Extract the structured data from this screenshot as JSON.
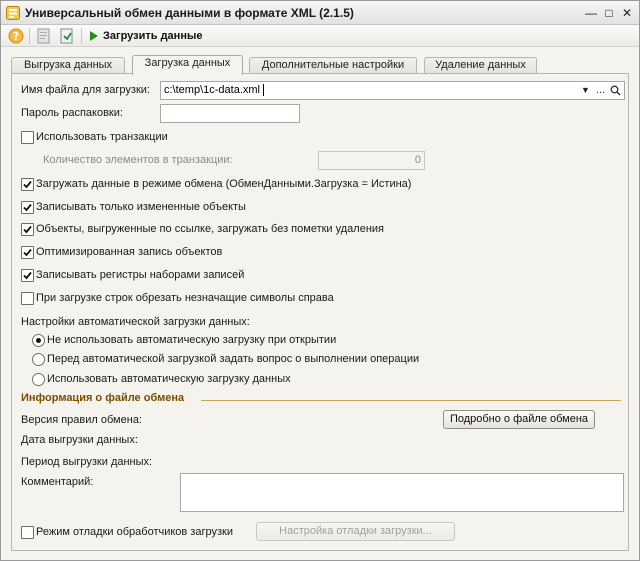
{
  "window": {
    "title": "Универсальный обмен данными в формате XML (2.1.5)"
  },
  "toolbar": {
    "load_label": "Загрузить данные"
  },
  "tabs": [
    {
      "label": "Выгрузка данных"
    },
    {
      "label": "Загрузка данных"
    },
    {
      "label": "Дополнительные настройки"
    },
    {
      "label": "Удаление данных"
    }
  ],
  "load": {
    "file_label": "Имя файла для загрузки:",
    "file_value": "c:\\temp\\1c-data.xml",
    "ellipsis": "...",
    "password_label": "Пароль распаковки:",
    "password_value": "",
    "use_transactions_label": "Использовать транзакции",
    "use_transactions_checked": false,
    "tx_count_label": "Количество элементов в транзакции:",
    "tx_count_value": "0",
    "options": [
      {
        "label": "Загружать данные в режиме обмена (ОбменДанными.Загрузка = Истина)",
        "checked": true
      },
      {
        "label": "Записывать только измененные объекты",
        "checked": true
      },
      {
        "label": "Объекты, выгруженные по ссылке, загружать без пометки удаления",
        "checked": true
      },
      {
        "label": "Оптимизированная запись объектов",
        "checked": true
      },
      {
        "label": "Записывать регистры наборами записей",
        "checked": true
      },
      {
        "label": "При загрузке строк обрезать незначащие символы справа",
        "checked": false
      }
    ],
    "auto_label": "Настройки автоматической загрузки данных:",
    "auto_options": [
      {
        "label": "Не использовать автоматическую загрузку при открытии",
        "selected": true
      },
      {
        "label": "Перед автоматической загрузкой задать вопрос о выполнении операции",
        "selected": false
      },
      {
        "label": "Использовать автоматическую загрузку данных",
        "selected": false
      }
    ]
  },
  "info": {
    "section_title": "Информация о файле обмена",
    "rules_version_label": "Версия правил обмена:",
    "details_button": "Подробно о файле обмена",
    "export_date_label": "Дата выгрузки данных:",
    "export_period_label": "Период выгрузки данных:",
    "comment_label": "Комментарий:",
    "comment_value": ""
  },
  "debug": {
    "mode_label": "Режим отладки обработчиков загрузки",
    "mode_checked": false,
    "settings_button": "Настройка отладки загрузки..."
  },
  "colors": {
    "section_title": "#7a4d00",
    "section_line": "#c7a45e",
    "run_arrow": "#2c8a1c"
  }
}
